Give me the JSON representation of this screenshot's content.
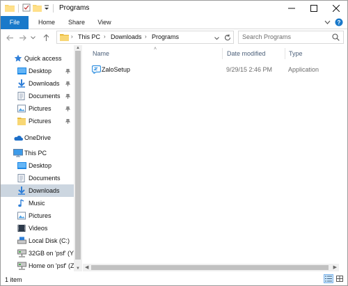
{
  "window": {
    "title": "Programs"
  },
  "ribbon": {
    "tabs": [
      {
        "label": "File"
      },
      {
        "label": "Home"
      },
      {
        "label": "Share"
      },
      {
        "label": "View"
      }
    ]
  },
  "address": {
    "crumbs": [
      "This PC",
      "Downloads",
      "Programs"
    ]
  },
  "search": {
    "placeholder": "Search Programs"
  },
  "nav": {
    "quick_access": "Quick access",
    "quick_items": [
      {
        "label": "Desktop",
        "icon": "desktop-folder-icon",
        "pinned": true
      },
      {
        "label": "Downloads",
        "icon": "downloads-icon",
        "pinned": true
      },
      {
        "label": "Documents",
        "icon": "documents-icon",
        "pinned": true
      },
      {
        "label": "Pictures",
        "icon": "pictures-icon",
        "pinned": true
      },
      {
        "label": "Pictures",
        "icon": "folder-icon",
        "pinned": true
      }
    ],
    "onedrive": "OneDrive",
    "this_pc": "This PC",
    "pc_items": [
      {
        "label": "Desktop",
        "icon": "desktop-folder-icon"
      },
      {
        "label": "Documents",
        "icon": "documents-icon"
      },
      {
        "label": "Downloads",
        "icon": "downloads-icon",
        "selected": true
      },
      {
        "label": "Music",
        "icon": "music-icon"
      },
      {
        "label": "Pictures",
        "icon": "pictures-icon"
      },
      {
        "label": "Videos",
        "icon": "videos-icon"
      },
      {
        "label": "Local Disk (C:)",
        "icon": "local-disk-icon"
      },
      {
        "label": "32GB on 'psf' (Y:",
        "icon": "network-drive-icon"
      },
      {
        "label": "Home on 'psf' (Z",
        "icon": "network-drive-icon"
      }
    ]
  },
  "columns": {
    "name": "Name",
    "date": "Date modified",
    "type": "Type"
  },
  "files": [
    {
      "name": "ZaloSetup",
      "date": "9/29/15 2:46 PM",
      "type": "Application",
      "icon": "zalo-app-icon"
    }
  ],
  "status": {
    "count": "1 item"
  },
  "colors": {
    "accent": "#1979ca",
    "selection": "#ccd6e0",
    "folder": "#f8d775"
  }
}
